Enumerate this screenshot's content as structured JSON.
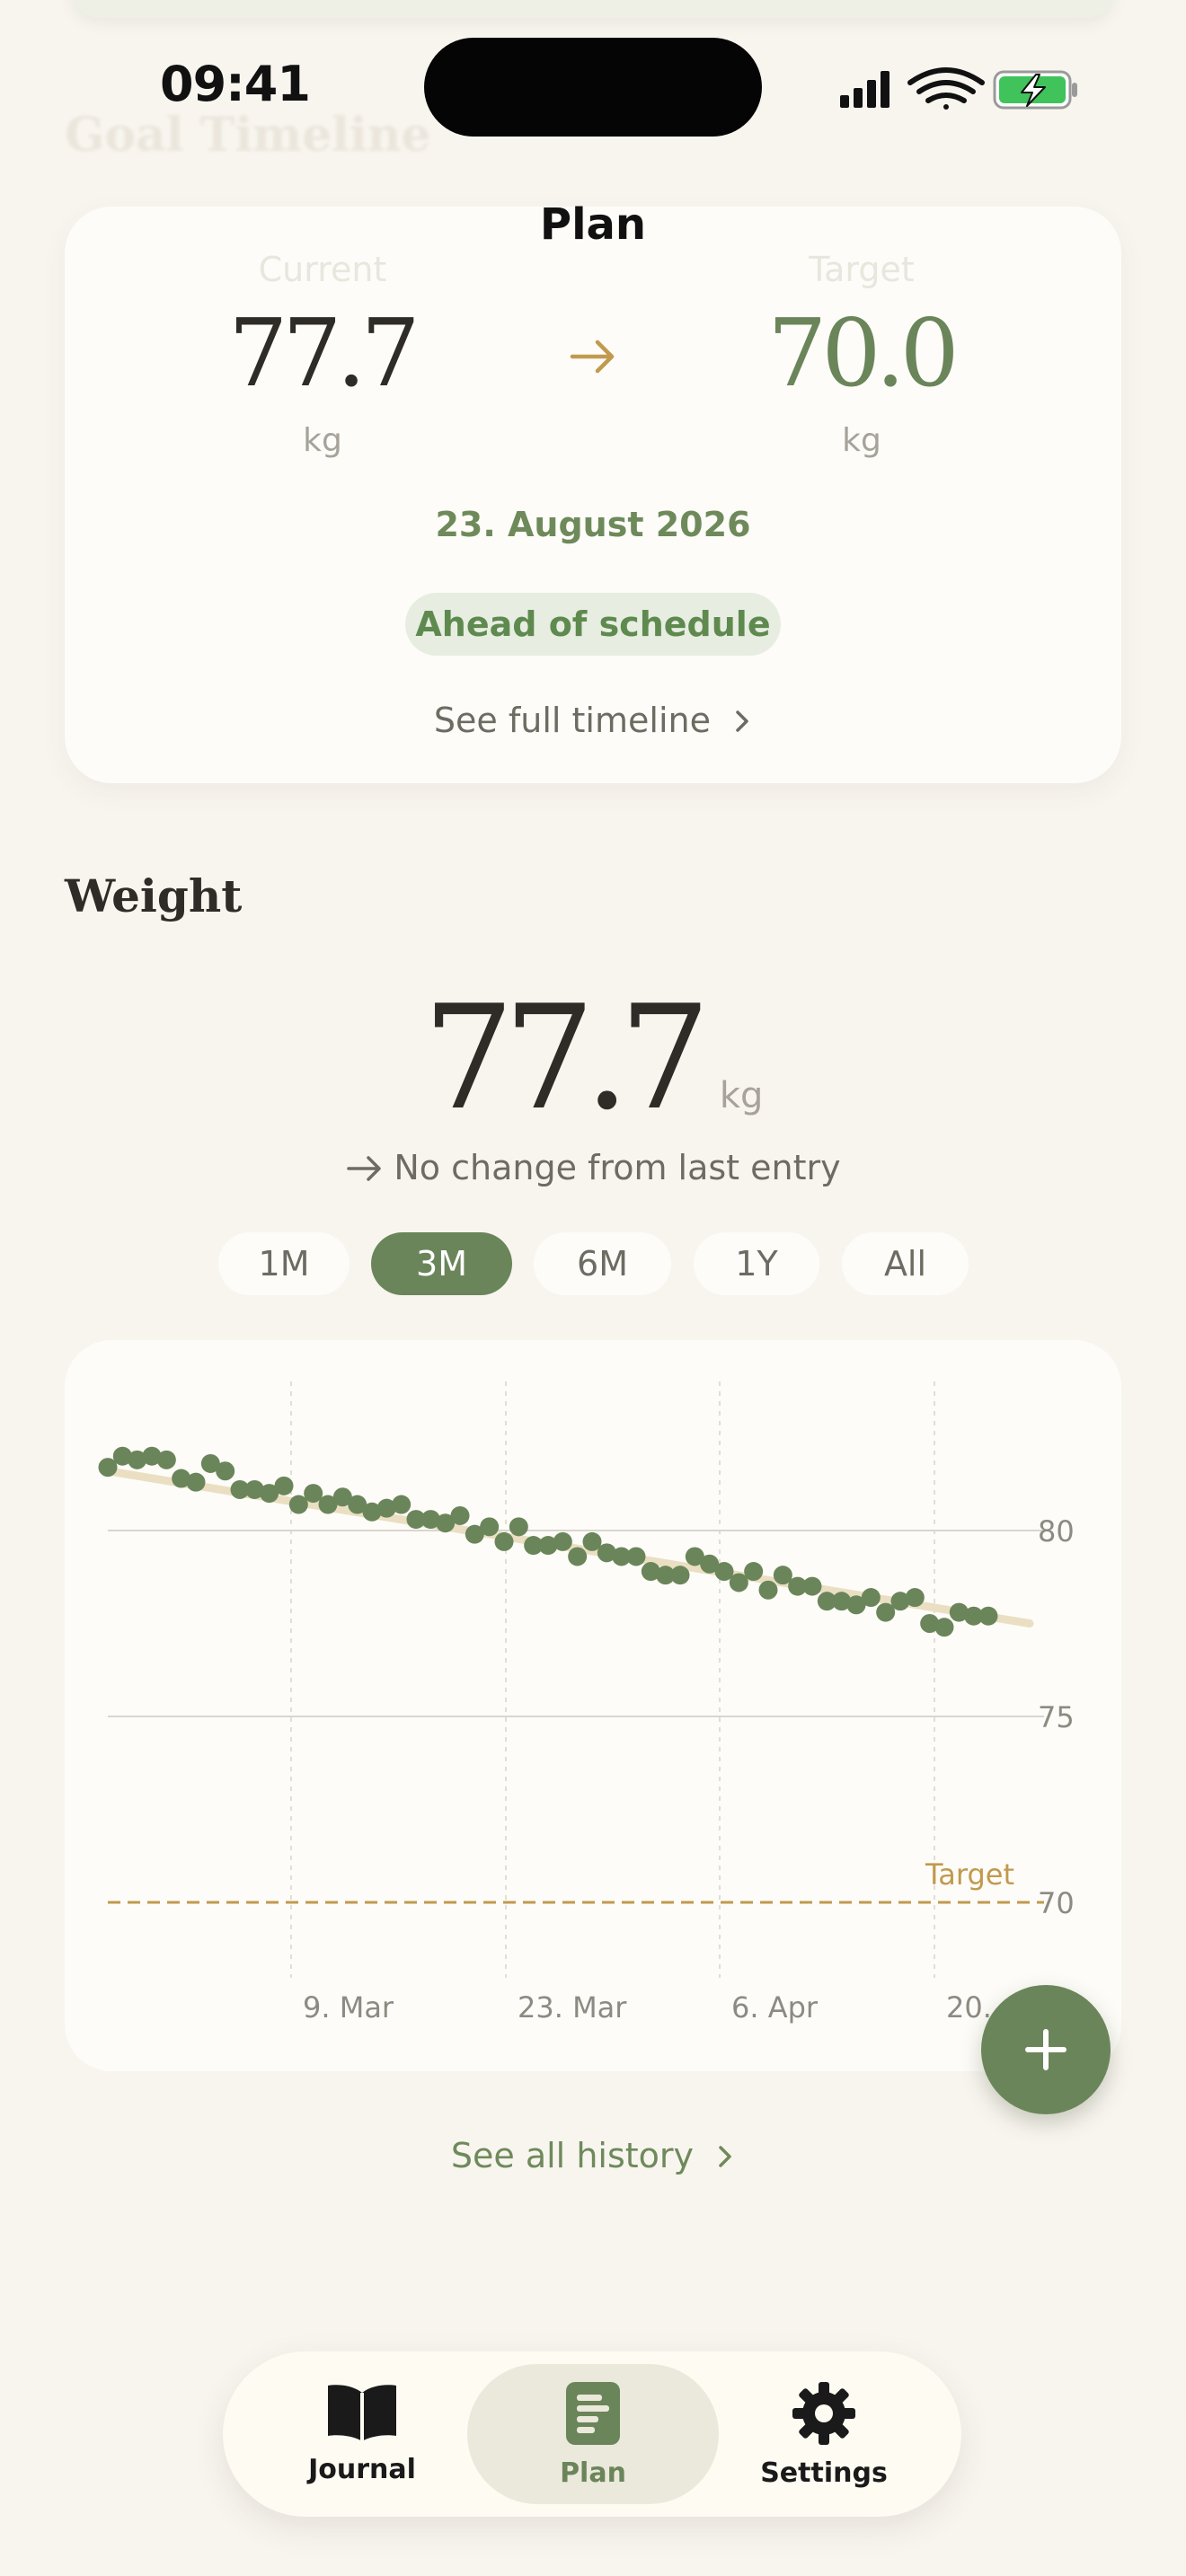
{
  "status_bar": {
    "time": "09:41"
  },
  "nav": {
    "title": "Plan",
    "faded_heading": "Goal Timeline"
  },
  "goal_card": {
    "current_label": "Current",
    "current_value": "77.7",
    "current_unit": "kg",
    "target_label": "Target",
    "target_value": "70.0",
    "target_unit": "kg",
    "date": "23. August 2026",
    "status_badge": "Ahead of schedule",
    "timeline_link": "See full timeline"
  },
  "weight": {
    "title": "Weight",
    "value": "77.7",
    "unit": "kg",
    "change_text": "No change from last entry"
  },
  "ranges": {
    "items": [
      "1M",
      "3M",
      "6M",
      "1Y",
      "All"
    ],
    "selected": "3M"
  },
  "chart_data": {
    "type": "scatter",
    "x_tick_labels": [
      "9. Mar",
      "23. Mar",
      "6. Apr",
      "20."
    ],
    "y_ticks": [
      80,
      75,
      70
    ],
    "ylim": [
      68.5,
      82.5
    ],
    "target_value": 70,
    "target_label": "Target",
    "trend": {
      "start": 81.6,
      "end": 77.5
    },
    "series": [
      {
        "values": [
          81.7,
          82.0,
          81.9,
          82.0,
          81.9,
          81.4,
          81.3,
          81.8,
          81.6,
          81.1,
          81.1,
          81.0,
          81.2,
          80.7,
          81.0,
          80.7,
          80.9,
          80.7,
          80.5,
          80.6,
          80.7,
          80.3,
          80.3,
          80.2,
          80.4,
          79.9,
          80.1,
          79.7,
          80.1,
          79.6,
          79.6,
          79.7,
          79.3,
          79.7,
          79.4,
          79.3,
          79.3,
          78.9,
          78.8,
          78.8,
          79.3,
          79.1,
          78.9,
          78.6,
          78.9,
          78.4,
          78.8,
          78.5,
          78.5,
          78.1,
          78.1,
          78.0,
          78.2,
          77.8,
          78.1,
          78.2,
          77.5,
          77.4,
          77.8,
          77.7,
          77.7
        ]
      }
    ],
    "grid": true
  },
  "history_link": "See all history",
  "tabbar": {
    "tabs": [
      "Journal",
      "Plan",
      "Settings"
    ],
    "active": "Plan"
  },
  "colors": {
    "accent": "#6b855a",
    "target": "#c09a4e",
    "background": "#f8f5ef",
    "card": "#fdfcf8"
  }
}
